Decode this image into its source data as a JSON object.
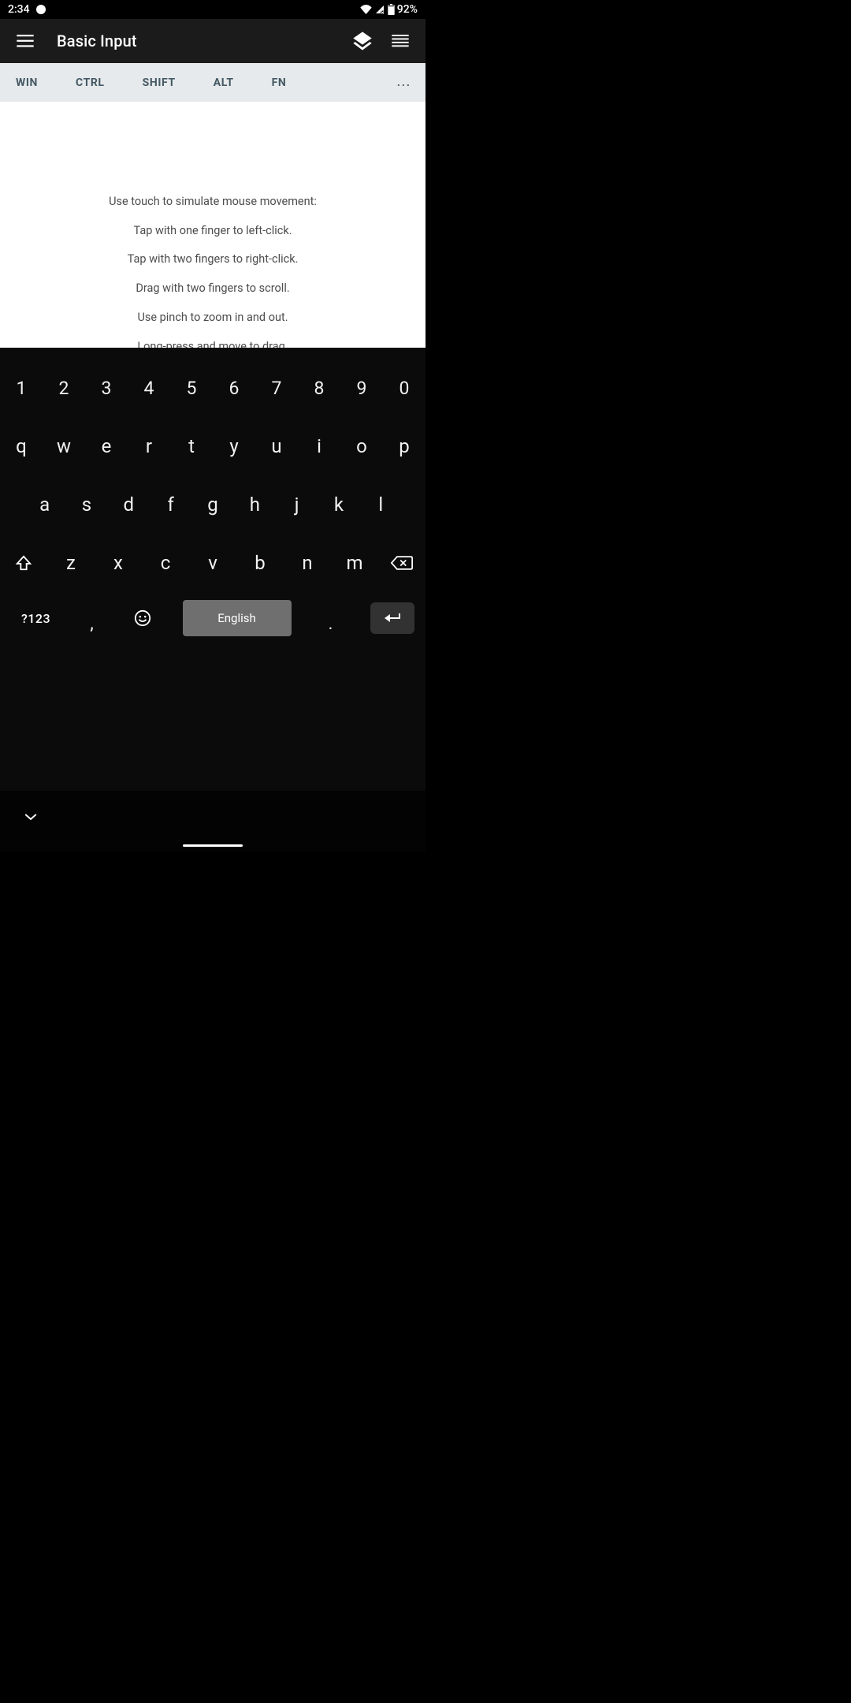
{
  "statusbar": {
    "time": "2:34",
    "battery": "92%"
  },
  "appbar": {
    "title": "Basic Input"
  },
  "modkeys": [
    "WIN",
    "CTRL",
    "SHIFT",
    "ALT",
    "FN"
  ],
  "modmore": "...",
  "instructions": [
    "Use touch to simulate mouse movement:",
    "Tap with one finger to left-click.",
    "Tap with two fingers to right-click.",
    "Drag with two fingers to scroll.",
    "Use pinch to zoom in and out.",
    "Long-press and move to drag."
  ],
  "keyboard": {
    "row_nums": [
      "1",
      "2",
      "3",
      "4",
      "5",
      "6",
      "7",
      "8",
      "9",
      "0"
    ],
    "row_top": [
      "q",
      "w",
      "e",
      "r",
      "t",
      "y",
      "u",
      "i",
      "o",
      "p"
    ],
    "row_mid": [
      "a",
      "s",
      "d",
      "f",
      "g",
      "h",
      "j",
      "k",
      "l"
    ],
    "row_bot": [
      "z",
      "x",
      "c",
      "v",
      "b",
      "n",
      "m"
    ],
    "sym": "?123",
    "comma": ",",
    "dot": ".",
    "space_label": "English"
  }
}
